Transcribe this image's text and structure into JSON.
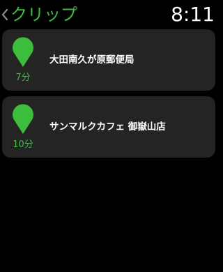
{
  "header": {
    "back_title": "クリップ",
    "time": "8:11"
  },
  "colors": {
    "accent": "#3dbd3d",
    "card_background": "#242424",
    "pin": "#3dbd3d"
  },
  "clips": [
    {
      "name": "大田南久が原郵便局",
      "minutes": "7分",
      "icon": "map-pin-icon"
    },
    {
      "name": "サンマルクカフェ 御嶽山店",
      "minutes": "10分",
      "icon": "map-pin-icon"
    }
  ]
}
